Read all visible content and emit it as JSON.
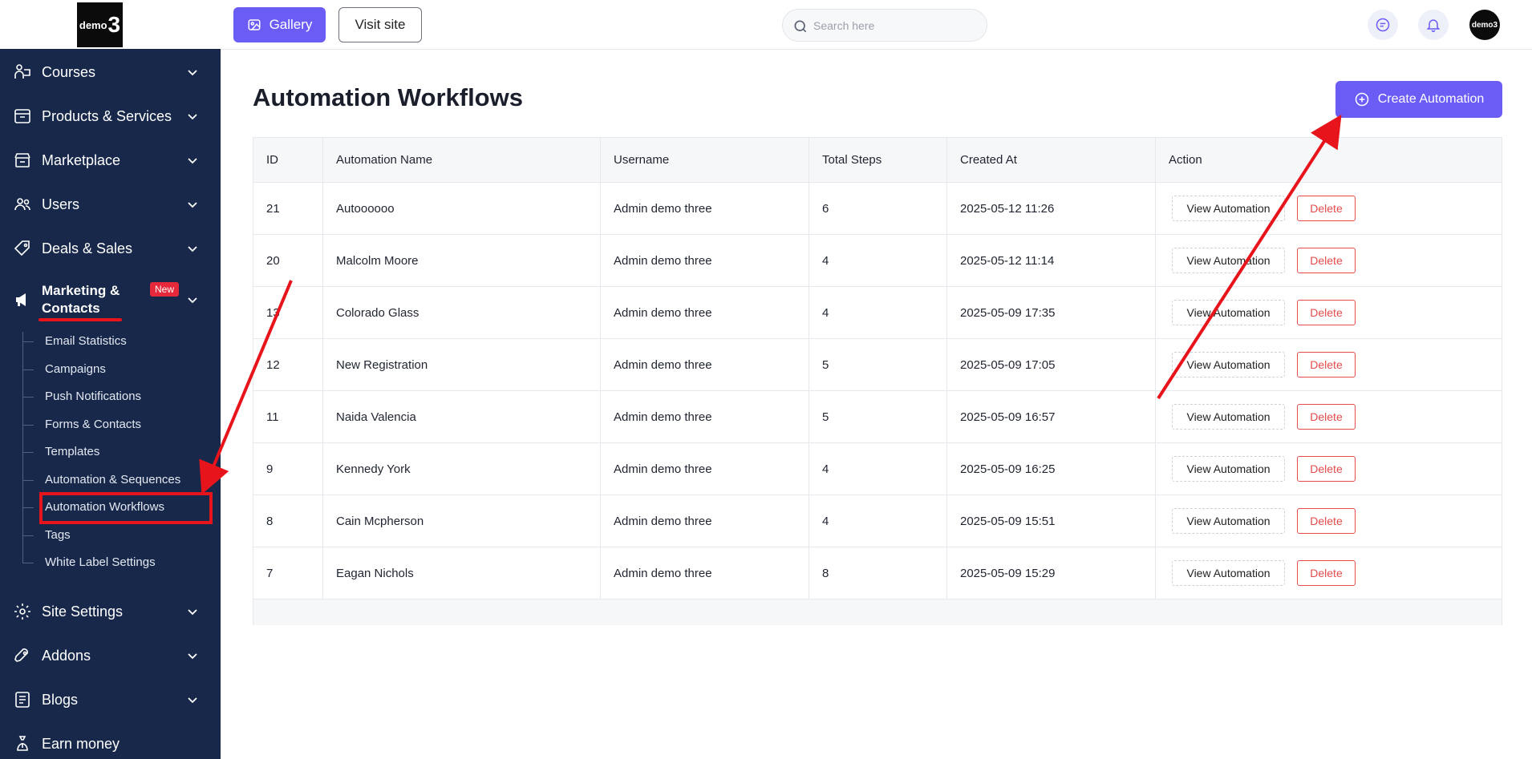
{
  "logo": {
    "text_small": "demo",
    "text_big": "3"
  },
  "header": {
    "gallery_label": "Gallery",
    "visit_label": "Visit site",
    "search_placeholder": "Search here",
    "avatar_text": "demo3"
  },
  "sidebar": {
    "items": [
      {
        "label": "Courses"
      },
      {
        "label": "Products & Services"
      },
      {
        "label": "Marketplace"
      },
      {
        "label": "Users"
      },
      {
        "label": "Deals & Sales"
      }
    ],
    "marketing": {
      "label": "Marketing & Contacts",
      "badge": "New"
    },
    "sub_items": [
      "Email Statistics",
      "Campaigns",
      "Push Notifications",
      "Forms & Contacts",
      "Templates",
      "Automation & Sequences",
      "Automation Workflows",
      "Tags",
      "White Label Settings"
    ],
    "bottom_items": [
      {
        "label": "Site Settings"
      },
      {
        "label": "Addons"
      },
      {
        "label": "Blogs"
      },
      {
        "label": "Earn money"
      }
    ]
  },
  "main": {
    "title": "Automation Workflows",
    "create_label": "Create Automation",
    "view_label": "View Automation",
    "delete_label": "Delete",
    "columns": [
      "ID",
      "Automation Name",
      "Username",
      "Total Steps",
      "Created At",
      "Action"
    ],
    "rows": [
      {
        "id": "21",
        "name": "Autoooooo",
        "username": "Admin demo three",
        "steps": "6",
        "created": "2025-05-12 11:26"
      },
      {
        "id": "20",
        "name": "Malcolm Moore",
        "username": "Admin demo three",
        "steps": "4",
        "created": "2025-05-12 11:14"
      },
      {
        "id": "13",
        "name": "Colorado Glass",
        "username": "Admin demo three",
        "steps": "4",
        "created": "2025-05-09 17:35"
      },
      {
        "id": "12",
        "name": "New Registration",
        "username": "Admin demo three",
        "steps": "5",
        "created": "2025-05-09 17:05"
      },
      {
        "id": "11",
        "name": "Naida Valencia",
        "username": "Admin demo three",
        "steps": "5",
        "created": "2025-05-09 16:57"
      },
      {
        "id": "9",
        "name": "Kennedy York",
        "username": "Admin demo three",
        "steps": "4",
        "created": "2025-05-09 16:25"
      },
      {
        "id": "8",
        "name": "Cain Mcpherson",
        "username": "Admin demo three",
        "steps": "4",
        "created": "2025-05-09 15:51"
      },
      {
        "id": "7",
        "name": "Eagan Nichols",
        "username": "Admin demo three",
        "steps": "8",
        "created": "2025-05-09 15:29"
      }
    ]
  },
  "colors": {
    "sidebar_bg": "#17284a",
    "accent": "#6a5cf5",
    "danger": "#e54b4b",
    "annotation": "#e8141c",
    "badge": "#e5293b"
  }
}
